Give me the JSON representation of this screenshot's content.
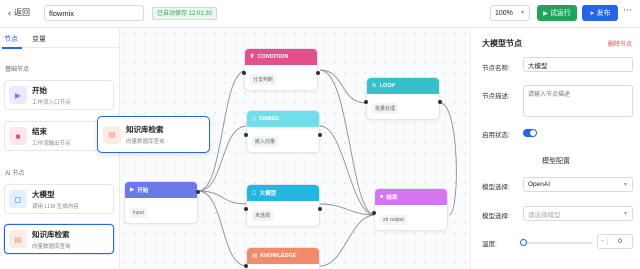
{
  "topbar": {
    "back_label": "返回",
    "workflow_name": "flowmix",
    "save_status": "已自动保存 12:01:30",
    "zoom": "100%",
    "run_label": "试运行",
    "publish_label": "发布",
    "more": "⋯"
  },
  "sidebar": {
    "tabs": [
      "节点",
      "变量"
    ],
    "groups": [
      {
        "title": "基础节点",
        "items": [
          {
            "title": "开始",
            "desc": "工作流入口节点",
            "color": "#8b7cf6",
            "icon": "▶"
          },
          {
            "title": "结束",
            "desc": "工作流输出节点",
            "color": "#e2457a",
            "icon": "■"
          }
        ]
      },
      {
        "title": "AI 节点",
        "items": [
          {
            "title": "大模型",
            "desc": "调用 LLM 生成内容",
            "color": "#2b7de9",
            "icon": "◻"
          },
          {
            "title": "知识库检索",
            "desc": "向量数据库查询",
            "color": "#f39a7a",
            "icon": "▤"
          }
        ]
      }
    ]
  },
  "canvas": {
    "nodes": {
      "condition": {
        "title": "CONDITION",
        "chip": "分支判断",
        "color": "#e3508a",
        "icon": "⊽"
      },
      "loop": {
        "title": "LOOP",
        "chip": "批量处理",
        "color": "#36c0cc",
        "icon": "↻"
      },
      "embed": {
        "title": "EMBED",
        "chip": "嵌入向量",
        "color": "#6fe0ea",
        "icon": "◇"
      },
      "start": {
        "title": "开始",
        "chip": "input",
        "color": "#6a7be8",
        "icon": "▶"
      },
      "llm": {
        "title": "大模型",
        "chip": "未选择",
        "color": "#23b7e0",
        "icon": "◻"
      },
      "end": {
        "title": "结束",
        "chip": "str output",
        "color": "#d576f0",
        "icon": "■"
      },
      "knowledge": {
        "title": "KNOWLEDGE",
        "chip": "",
        "color": "#f28a6c",
        "icon": "▤"
      }
    },
    "drag_preview": {
      "title": "知识库检索",
      "desc": "向量数据库查询"
    }
  },
  "panel": {
    "title": "大模型节点",
    "delete_label": "删除节点",
    "node_name_label": "节点名称:",
    "node_name_value": "大模型",
    "node_desc_label": "节点描述:",
    "node_desc_placeholder": "请输入节点描述",
    "enabled_label": "启用状态:",
    "model_section": "模型配置",
    "model_choice_label": "模型选择:",
    "model_choice_value": "OpenAI",
    "model_select_label": "模型选择:",
    "model_select_placeholder": "请选择模型",
    "temperature_label": "温度:",
    "temperature_value": "0"
  }
}
